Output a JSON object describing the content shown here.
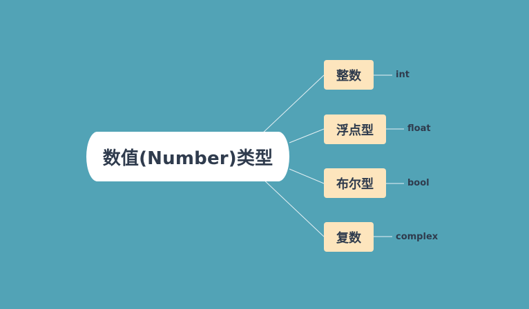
{
  "mindmap": {
    "root": {
      "label": "数值(Number)类型"
    },
    "branches": [
      {
        "label": "整数",
        "leaf": "int"
      },
      {
        "label": "浮点型",
        "leaf": "float"
      },
      {
        "label": "布尔型",
        "leaf": "bool"
      },
      {
        "label": "复数",
        "leaf": "complex"
      }
    ]
  },
  "colors": {
    "background": "#52a3b6",
    "root_fill": "#ffffff",
    "branch_fill": "#fde5bd",
    "text": "#2f3b4d",
    "connector": "#e8f2f5"
  }
}
